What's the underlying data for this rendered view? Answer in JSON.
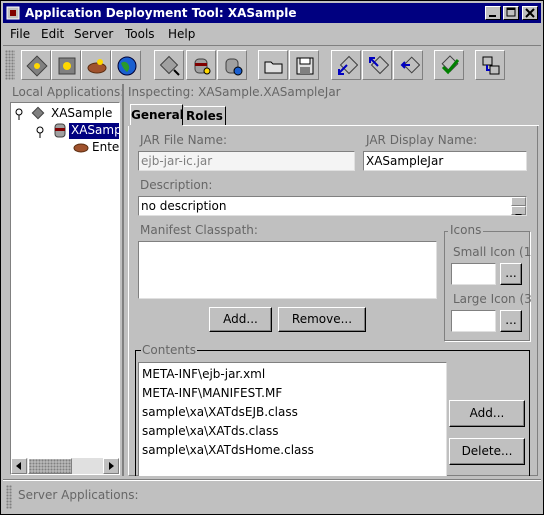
{
  "window": {
    "title": "Application Deployment Tool: XASample"
  },
  "colors": {
    "titlebar": "#000080",
    "selection": "#000080",
    "panel": "#c0c0c0"
  },
  "menu": [
    {
      "label": "File"
    },
    {
      "label": "Edit"
    },
    {
      "label": "Server"
    },
    {
      "label": "Tools"
    },
    {
      "label": "Help"
    }
  ],
  "toolbar": {
    "icons": [
      "new-application-icon",
      "new-ejb-icon",
      "new-web-icon",
      "globe-icon",
      "add-application-icon",
      "add-ejb-jar-icon",
      "add-web-war-icon",
      "open-folder-icon",
      "save-icon",
      "deploy-icon",
      "undeploy-icon",
      "update-icon",
      "verify-icon",
      "server-icon"
    ]
  },
  "left": {
    "header": "Local Applications:",
    "tree": [
      {
        "label": "XASample"
      },
      {
        "label": "XASamp"
      },
      {
        "label": "Ente"
      }
    ]
  },
  "right": {
    "header": "Inspecting: XASample.XASampleJar",
    "tabs": [
      {
        "label": "General"
      },
      {
        "label": "Roles"
      }
    ],
    "jar_file_label": "JAR File Name:",
    "jar_file_value": "ejb-jar-ic.jar",
    "jar_display_label": "JAR Display Name:",
    "jar_display_value": "XASampleJar",
    "description_label": "Description:",
    "description_value": "no description",
    "manifest_label": "Manifest Classpath:",
    "add_button": "Add...",
    "remove_button": "Remove...",
    "icons_group": "Icons",
    "small_icon_label": "Small Icon (1",
    "large_icon_label": "Large Icon (3",
    "browse_label": "...",
    "contents_label": "Contents",
    "contents": [
      "META-INF\\ejb-jar.xml",
      "META-INF\\MANIFEST.MF",
      "sample\\xa\\XATdsEJB.class",
      "sample\\xa\\XATds.class",
      "sample\\xa\\XATdsHome.class"
    ],
    "contents_add_button": "Add...",
    "contents_delete_button": "Delete..."
  },
  "status": {
    "server_applications": "Server Applications:"
  }
}
